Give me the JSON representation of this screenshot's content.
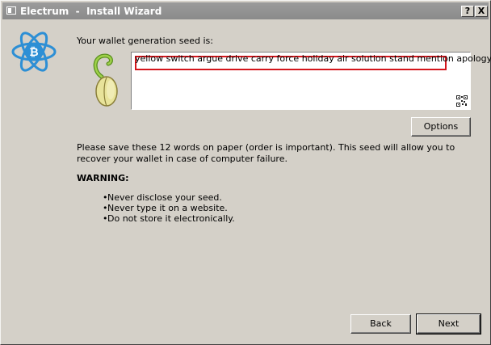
{
  "window": {
    "title": "Electrum  -  Install Wizard",
    "help_label": "?",
    "close_label": "X"
  },
  "prompt": "Your wallet generation seed is:",
  "seed": {
    "words": "yellow switch argue drive carry force holiday air solution stand mention apology",
    "highlight_color": "#d4161c"
  },
  "options_label": "Options",
  "instruction": "Please save these 12 words on paper (order is important). This seed will allow you to recover your wallet in case of computer failure.",
  "warning_title": "WARNING:",
  "warnings": [
    {
      "text": "Never disclose your seed."
    },
    {
      "text": "Never type it on a website."
    },
    {
      "text": "Do not store it electronically."
    }
  ],
  "buttons": {
    "back": "Back",
    "next": "Next"
  },
  "colors": {
    "electrum_blue": "#2d8fd5",
    "seed_green": "#8bc23a"
  },
  "icons": [
    "electrum-logo-icon",
    "sprouting-seed-icon",
    "qr-code-icon"
  ]
}
